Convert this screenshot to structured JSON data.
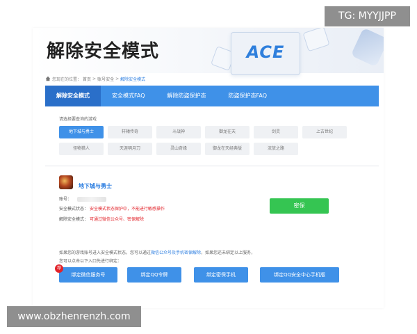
{
  "header": {
    "title": "解除安全模式",
    "logo_text": "ACE"
  },
  "breadcrumb": {
    "prefix": "您现在的位置：",
    "home": "首页",
    "sep": ">",
    "section": "账号安全",
    "current": "解除安全模式"
  },
  "tabs": [
    {
      "label": "解除安全模式",
      "active": true
    },
    {
      "label": "安全模式FAQ",
      "active": false
    },
    {
      "label": "解除防盗保护态",
      "active": false
    },
    {
      "label": "防盗保护态FAQ",
      "active": false
    }
  ],
  "game_select": {
    "prompt": "请选择要查询的游戏",
    "games": [
      {
        "label": "地下城与勇士",
        "selected": true
      },
      {
        "label": "轩辕传奇",
        "selected": false
      },
      {
        "label": "斗战神",
        "selected": false
      },
      {
        "label": "御龙在天",
        "selected": false
      },
      {
        "label": "剑灵",
        "selected": false
      },
      {
        "label": "上古世纪",
        "selected": false
      },
      {
        "label": "怪物猎人",
        "selected": false
      },
      {
        "label": "天涯明月刀",
        "selected": false
      },
      {
        "label": "灵山奇缘",
        "selected": false
      },
      {
        "label": "御龙在天经典版",
        "selected": false
      },
      {
        "label": "流放之路",
        "selected": false
      }
    ]
  },
  "account": {
    "game_name": "地下城与勇士",
    "account_label": "账号：",
    "safe_mode_label": "安全模式状态：",
    "safe_mode_value": "安全模式状态保护中，不能进行敏感操作",
    "unlock_label": "解除安全模式：",
    "unlock_value": "可通过微信公众号、密保解除",
    "mibao_button": "密保"
  },
  "notice": {
    "line1_a": "如果您的游戏账号进入安全模式状态，您可以通过",
    "line1_hl": "微信公众号及手机密保解除",
    "line1_b": "，如果您还未绑定以上服务，",
    "line2": "您可以点击以下入口先进行绑定："
  },
  "bind_buttons": {
    "recommend_badge": "荐",
    "wechat": "绑定微信服务号",
    "qq_token": "绑定QQ令牌",
    "phone": "绑定密保手机",
    "qq_app": "绑定QQ安全中心手机版"
  },
  "overlays": {
    "tg": "TG: MYYJJPP",
    "site": "www.obzhenrenzh.com"
  },
  "colors": {
    "accent": "#3f91e8",
    "active_tab": "#2a6fc9",
    "green": "#35c552",
    "warning": "#e2232a"
  }
}
